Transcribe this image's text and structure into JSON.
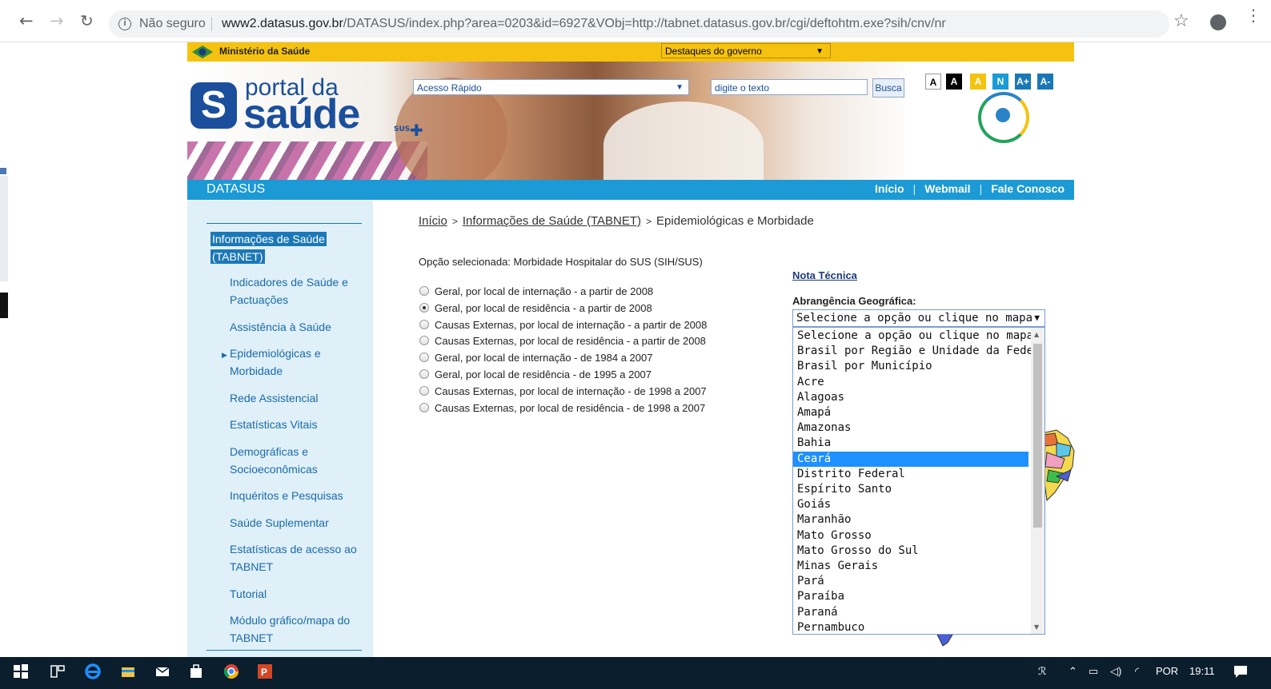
{
  "browser": {
    "security": "Não seguro",
    "url_domain": "www2.datasus.gov.br",
    "url_path": "/DATASUS/index.php?area=0203&id=6927&VObj=http://tabnet.datasus.gov.br/cgi/deftohtm.exe?sih/cnv/nr"
  },
  "govbar": {
    "ministry": "Ministério da Saúde",
    "destaques": "Destaques do governo"
  },
  "banner": {
    "logo_portal": "portal da",
    "logo_saude": "saúde",
    "logo_sus": "SUS",
    "acesso_rapido": "Acesso Rápido",
    "search_placeholder": "digite o texto",
    "search_button": "Busca",
    "font_buttons": [
      "A",
      "A",
      "A",
      "N",
      "A+",
      "A-"
    ]
  },
  "datasus_bar": {
    "title": "DATASUS",
    "links": [
      "Início",
      "Webmail",
      "Fale Conosco"
    ]
  },
  "sidebar": {
    "heading_line1": "Informações de Saúde",
    "heading_line2": "(TABNET)",
    "items": [
      {
        "l1": "Indicadores de Saúde e",
        "l2": "Pactuações"
      },
      {
        "l1": "Assistência à Saúde",
        "l2": ""
      },
      {
        "l1": "Epidemiológicas e",
        "l2": "Morbidade"
      },
      {
        "l1": "Rede Assistencial",
        "l2": ""
      },
      {
        "l1": "Estatísticas Vitais",
        "l2": ""
      },
      {
        "l1": "Demográficas e",
        "l2": "Socioeconômicas"
      },
      {
        "l1": "Inquéritos e Pesquisas",
        "l2": ""
      },
      {
        "l1": "Saúde Suplementar",
        "l2": ""
      },
      {
        "l1": "Estatísticas de acesso ao",
        "l2": "TABNET"
      },
      {
        "l1": "Tutorial",
        "l2": ""
      },
      {
        "l1": "Módulo gráfico/mapa do",
        "l2": "TABNET"
      }
    ]
  },
  "breadcrumb": {
    "home": "Início",
    "section": "Informações de Saúde (TABNET)",
    "current": "Epidemiológicas e Morbidade"
  },
  "main": {
    "opcao": "Opção selecionada: Morbidade Hospitalar do SUS (SIH/SUS)",
    "radios": [
      {
        "label": "Geral, por local de internação - a partir de 2008",
        "checked": false
      },
      {
        "label": "Geral, por local de residência - a partir de 2008",
        "checked": true
      },
      {
        "label": "Causas Externas, por local de internação - a partir de 2008",
        "checked": false
      },
      {
        "label": "Causas Externas, por local de residência - a partir de 2008",
        "checked": false
      },
      {
        "label": "Geral, por local de internação - de 1984 a 2007",
        "checked": false
      },
      {
        "label": "Geral, por local de residência - de 1995 a 2007",
        "checked": false
      },
      {
        "label": "Causas Externas, por local de internação - de 1998 a 2007",
        "checked": false
      },
      {
        "label": "Causas Externas, por local de residência - de 1998 a 2007",
        "checked": false
      }
    ],
    "nota_tecnica": "Nota Técnica",
    "abrangencia_label": "Abrangência Geográfica:",
    "select_value": "Selecione a opção ou clique no mapa",
    "options": [
      "Selecione a opção ou clique no mapa",
      "Brasil por Região e Unidade da Federação",
      "Brasil por Município",
      "Acre",
      "Alagoas",
      "Amapá",
      "Amazonas",
      "Bahia",
      "Ceará",
      "Distrito Federal",
      "Espírito Santo",
      "Goiás",
      "Maranhão",
      "Mato Grosso",
      "Mato Grosso do Sul",
      "Minas Gerais",
      "Pará",
      "Paraíba",
      "Paraná",
      "Pernambuco"
    ],
    "highlighted_option": "Ceará"
  },
  "taskbar": {
    "language": "POR",
    "time": "19:11"
  }
}
